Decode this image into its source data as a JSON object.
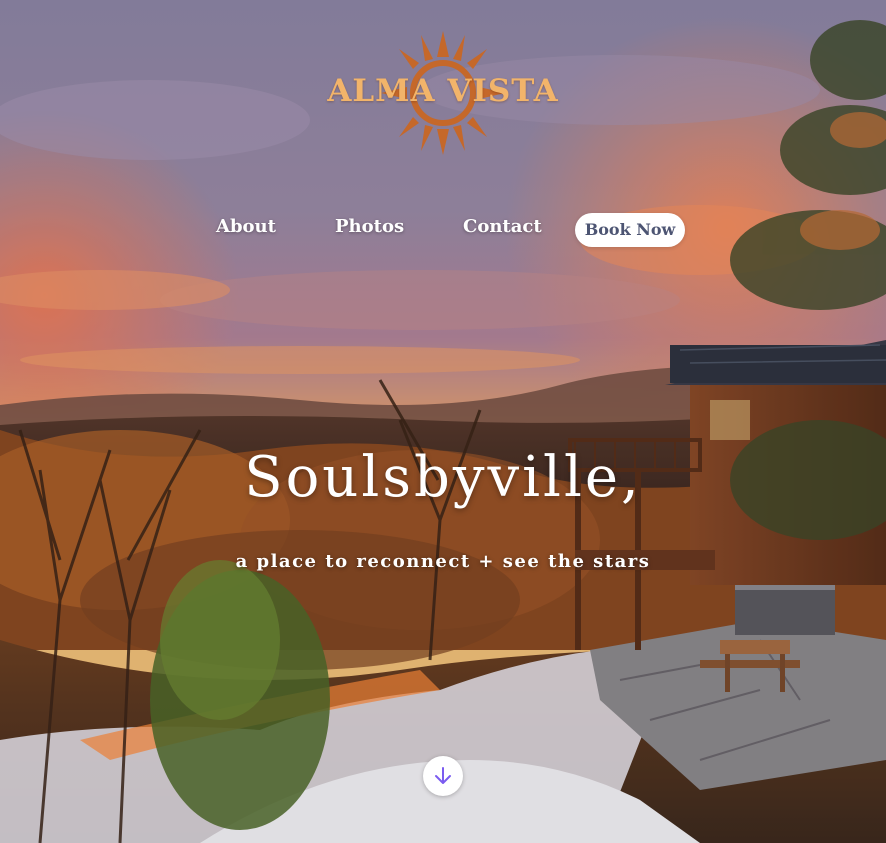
{
  "brand": {
    "name": "ALMA VISTA",
    "logo_icon": "sun-icon",
    "color": "#f2b46a"
  },
  "nav": {
    "items": [
      {
        "label": "About"
      },
      {
        "label": "Photos"
      },
      {
        "label": "Contact"
      }
    ],
    "cta_label": "Book Now"
  },
  "hero": {
    "headline": "Soulsbyville,",
    "tagline": "a place to reconnect + see the stars",
    "scroll_icon": "arrow-down-icon"
  },
  "colors": {
    "accent": "#7b5cf0",
    "button_text": "#4d5573"
  }
}
